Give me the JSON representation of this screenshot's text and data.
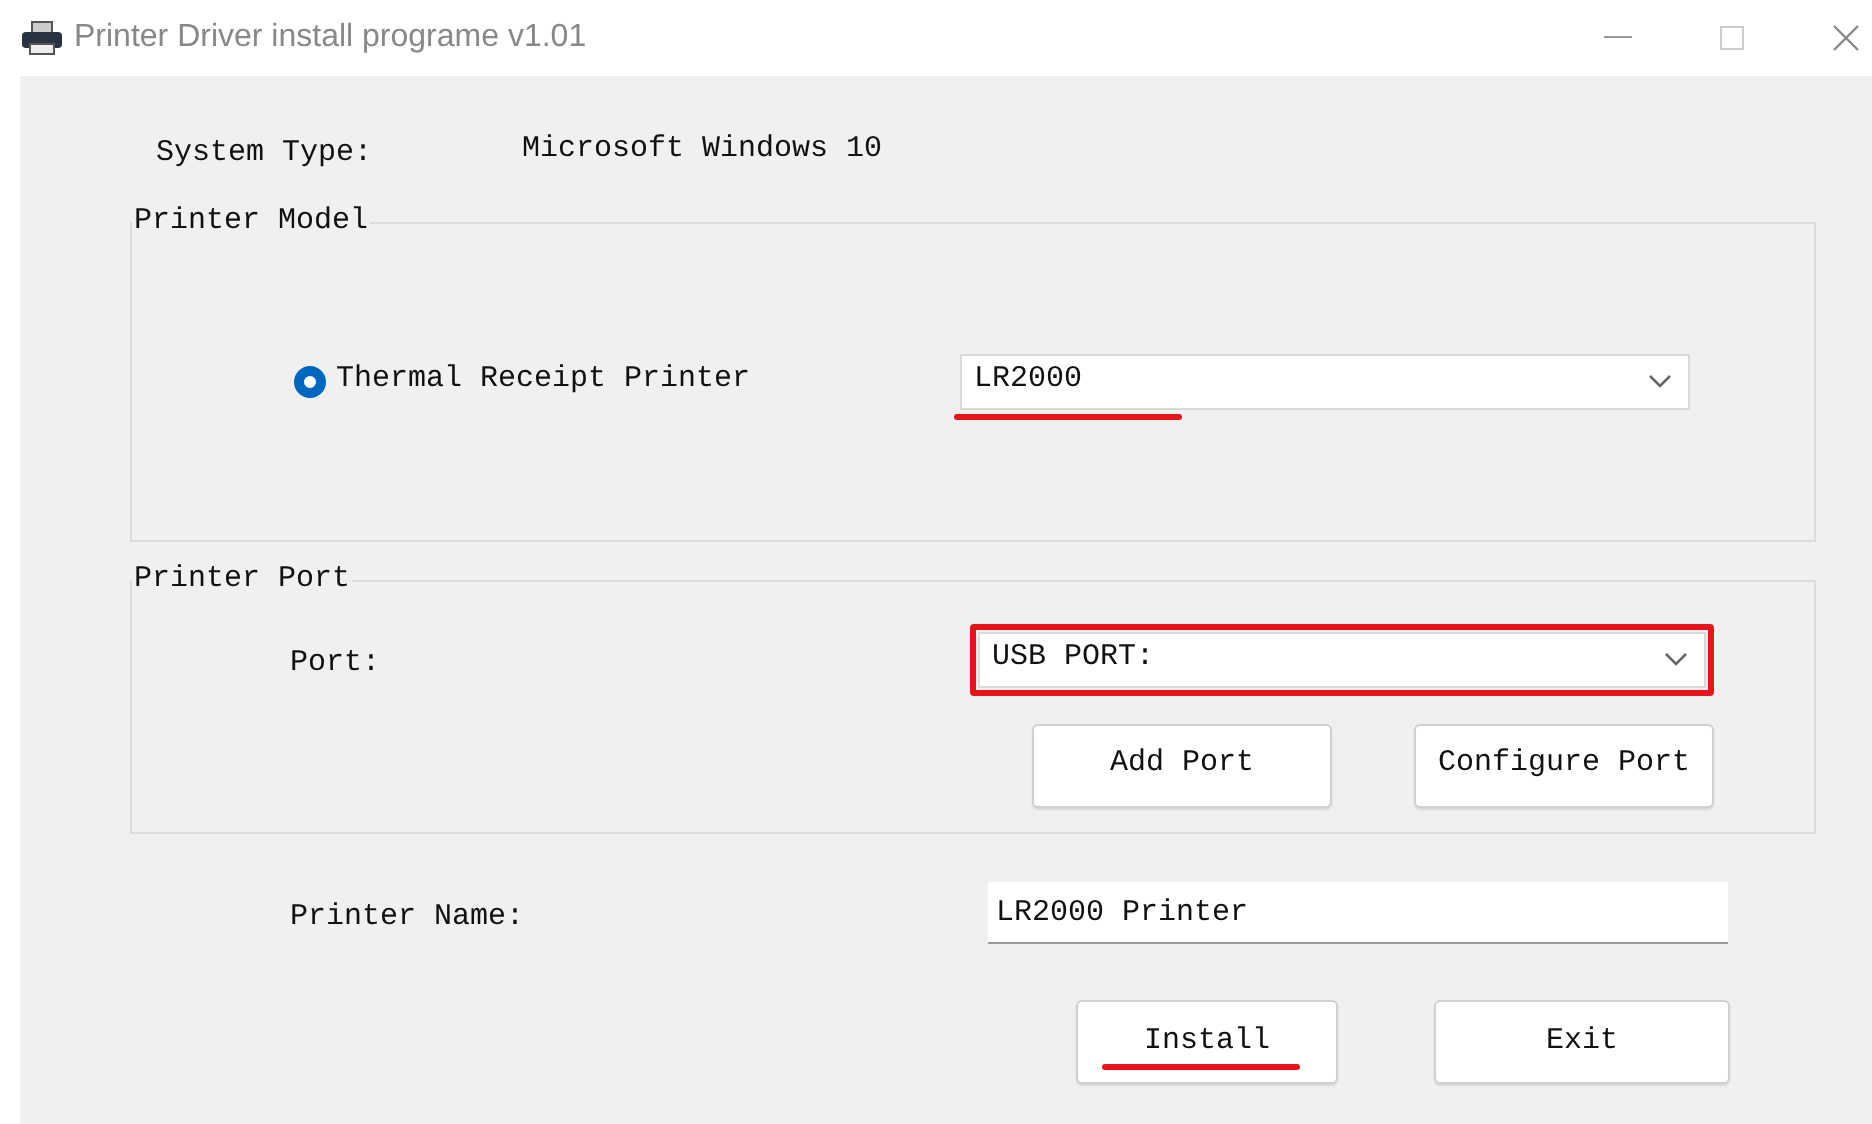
{
  "window": {
    "title": "Printer Driver install programe v1.01"
  },
  "system_type": {
    "label": "System Type:",
    "value": "Microsoft Windows 10"
  },
  "printer_model": {
    "legend": "Printer Model",
    "radio": {
      "label": "Thermal Receipt Printer",
      "selected": true
    },
    "model_select": {
      "value": "LR2000",
      "underlined": true,
      "boxed": false
    }
  },
  "printer_port": {
    "legend": "Printer Port",
    "port_label": "Port:",
    "port_select": {
      "value": "USB PORT:",
      "underlined": false,
      "boxed": true
    },
    "buttons": [
      {
        "label": "Add Port"
      },
      {
        "label": "Configure Port"
      }
    ]
  },
  "printer_name": {
    "label": "Printer Name:",
    "value": "LR2000 Printer"
  },
  "buttons": [
    {
      "label": "Install",
      "underlined": true
    },
    {
      "label": "Exit",
      "underlined": false
    }
  ]
}
